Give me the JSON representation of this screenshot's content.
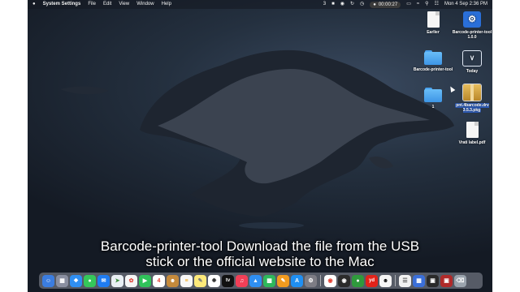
{
  "menubar": {
    "app_name": "System Settings",
    "menus": [
      "File",
      "Edit",
      "View",
      "Window",
      "Help"
    ],
    "badge_count": "3",
    "record_time": "00:00:27",
    "datetime": "Mon 4 Sep  2:36 PM"
  },
  "desktop_items": [
    {
      "label": "Earlier",
      "kind": "doc"
    },
    {
      "label": "Barcode-printer-tool 1.0.0",
      "kind": "tool"
    },
    {
      "label": "Barcode-printer-tool",
      "kind": "folder"
    },
    {
      "label": "Today",
      "kind": "today"
    },
    {
      "label": "1",
      "kind": "folder"
    },
    {
      "label": "pnt.4barcode.drv 3.5.3.pkg",
      "kind": "pkg"
    },
    {
      "label": "Vrati label.pdf",
      "kind": "pdf"
    }
  ],
  "caption": {
    "line1": "Barcode-printer-tool Download the file from the USB",
    "line2": "stick or the official website to the Mac"
  },
  "dock": {
    "calendar_day": "4",
    "tv_label": "tv",
    "yd_label": "yd"
  }
}
